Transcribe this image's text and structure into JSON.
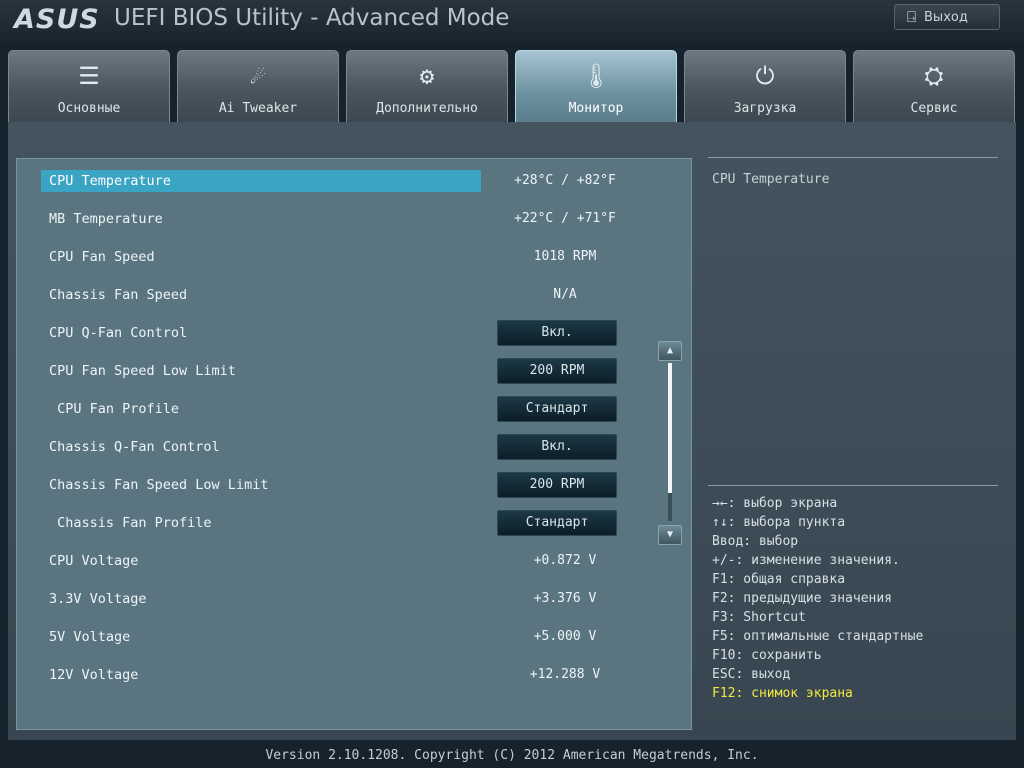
{
  "header": {
    "brand": "ASUS",
    "title": "UEFI BIOS Utility - Advanced Mode",
    "exit_label": "Выход"
  },
  "tabs": [
    {
      "label": "Основные",
      "icon": "list-icon",
      "glyph": "☰"
    },
    {
      "label": "Ai Tweaker",
      "icon": "tweaker-icon",
      "glyph": "☄"
    },
    {
      "label": "Дополнительно",
      "icon": "advanced-icon",
      "glyph": "⚙"
    },
    {
      "label": "Монитор",
      "icon": "thermometer-icon",
      "glyph": "🌡",
      "active": true
    },
    {
      "label": "Загрузка",
      "icon": "power-icon",
      "glyph": "⏻"
    },
    {
      "label": "Сервис",
      "icon": "toolbox-icon",
      "glyph": "⛭"
    }
  ],
  "rows": [
    {
      "label": "CPU Temperature",
      "value": "+28°C / +82°F",
      "type": "text",
      "selected": true
    },
    {
      "label": "MB Temperature",
      "value": "+22°C / +71°F",
      "type": "text"
    },
    {
      "label": "CPU Fan Speed",
      "value": "1018 RPM",
      "type": "text"
    },
    {
      "label": "Chassis Fan Speed",
      "value": "N/A",
      "type": "text"
    },
    {
      "label": "CPU Q-Fan Control",
      "value": "Вкл.",
      "type": "button"
    },
    {
      "label": "CPU Fan Speed Low Limit",
      "value": "200 RPM",
      "type": "button"
    },
    {
      "label": " CPU Fan Profile",
      "value": "Стандарт",
      "type": "button"
    },
    {
      "label": "Chassis Q-Fan Control",
      "value": "Вкл.",
      "type": "button"
    },
    {
      "label": "Chassis Fan Speed Low Limit",
      "value": "200 RPM",
      "type": "button"
    },
    {
      "label": " Chassis Fan Profile",
      "value": "Стандарт",
      "type": "button"
    },
    {
      "label": "CPU Voltage",
      "value": "+0.872 V",
      "type": "text"
    },
    {
      "label": "3.3V Voltage",
      "value": "+3.376 V",
      "type": "text"
    },
    {
      "label": "5V Voltage",
      "value": "+5.000 V",
      "type": "text"
    },
    {
      "label": "12V Voltage",
      "value": "+12.288 V",
      "type": "text"
    }
  ],
  "help": {
    "title": "CPU Temperature",
    "keys": [
      "→←: выбор экрана",
      "↑↓: выбора пункта",
      "Ввод: выбор",
      "+/-: изменение значения.",
      "F1: общая справка",
      "F2: предыдущие значения",
      "F3: Shortcut",
      "F5: оптимальные стандартные",
      "F10: сохранить",
      "ESC: выход",
      "F12: снимок экрана"
    ],
    "highlight_index": 10
  },
  "footer": "Version 2.10.1208. Copyright (C) 2012 American Megatrends, Inc.",
  "colors": {
    "selected_row": "#3aa4c4",
    "highlight_key": "#f3e93d"
  }
}
